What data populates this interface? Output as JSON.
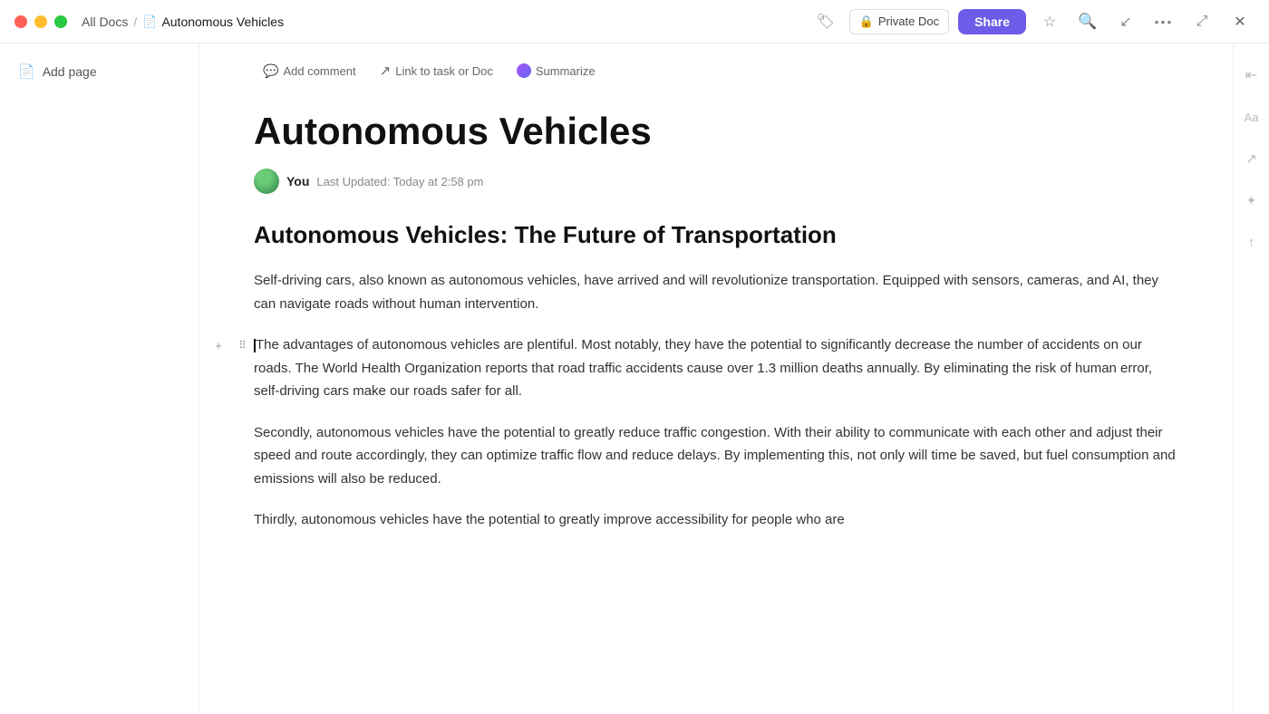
{
  "titlebar": {
    "all_docs_label": "All Docs",
    "doc_title": "Autonomous Vehicles",
    "private_doc_label": "Private Doc",
    "share_label": "Share"
  },
  "sidebar": {
    "add_page_label": "Add page"
  },
  "toolbar": {
    "add_comment_label": "Add comment",
    "link_task_label": "Link to task or Doc",
    "summarize_label": "Summarize"
  },
  "document": {
    "title": "Autonomous Vehicles",
    "author": "You",
    "last_updated": "Last Updated: Today at 2:58 pm",
    "heading": "Autonomous Vehicles: The Future of Transportation",
    "paragraph1": "Self-driving cars, also known as autonomous vehicles, have arrived and will revolutionize transportation. Equipped with sensors, cameras, and AI, they can navigate roads without human intervention.",
    "paragraph2": "The advantages of autonomous vehicles are plentiful. Most notably, they have the potential to significantly decrease the number of accidents on our roads. The World Health Organization reports that road traffic accidents cause over 1.3 million deaths annually. By eliminating the risk of human error, self-driving cars make our roads safer for all.",
    "paragraph3": "Secondly, autonomous vehicles have the potential to greatly reduce traffic congestion. With their ability to communicate with each other and adjust their speed and route accordingly, they can optimize traffic flow and reduce delays. By implementing this, not only will time be saved, but fuel consumption and emissions will also be reduced.",
    "paragraph4": "Thirdly, autonomous vehicles have the potential to greatly improve accessibility for people who are"
  },
  "icons": {
    "close": "✕",
    "minimize": "−",
    "maximize": "+",
    "doc": "📄",
    "lock": "🔒",
    "star": "☆",
    "search": "⌕",
    "export": "↓",
    "more": "•••",
    "fullscreen": "⤢",
    "add_page": "📄",
    "comment": "💬",
    "link": "↗",
    "tag": "🏷",
    "collapse": "⇤",
    "font": "Aa",
    "share_rt": "↗",
    "settings_rt": "✦",
    "upload_rt": "↑",
    "plus": "+",
    "drag": "⠿"
  }
}
